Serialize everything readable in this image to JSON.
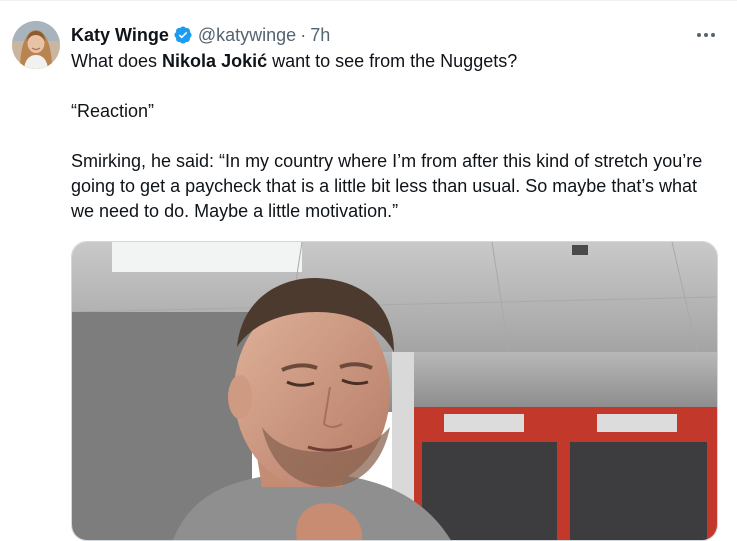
{
  "tweet": {
    "author_name": "Katy Winge",
    "handle": "@katywinge",
    "separator": "·",
    "time": "7h",
    "line1_prefix": "What does ",
    "line1_bold": "Nikola Jokić",
    "line1_suffix": " want to see from the Nuggets?",
    "line2": "“Reaction”",
    "line3": "Smirking, he said: “In my country where I’m from after this kind of stretch you’re going to get a paycheck that is a little bit less than usual. So maybe that’s what we need to do. Maybe a little motivation.”"
  },
  "icons": {
    "verified": "verified-badge-icon",
    "more": "more-options-icon"
  },
  "colors": {
    "verified_blue": "#1d9bf0",
    "secondary_text": "#536471",
    "primary_text": "#0f1419"
  }
}
